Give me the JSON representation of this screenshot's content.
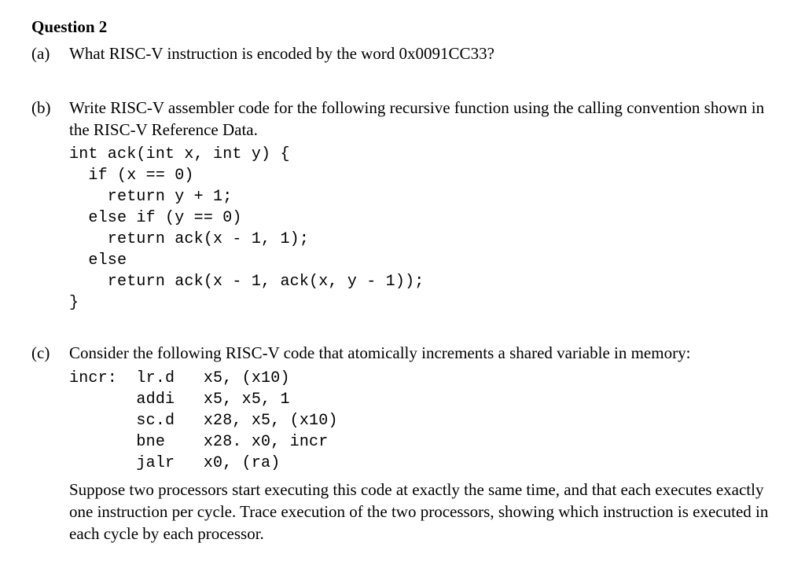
{
  "title": "Question 2",
  "parts": {
    "a": {
      "label": "(a)",
      "text": "What RISC-V instruction is encoded by the word 0x0091CC33?"
    },
    "b": {
      "label": "(b)",
      "text": "Write RISC-V assembler code for the following recursive function using the calling convention shown in the RISC-V Reference Data.",
      "code": "int ack(int x, int y) {\n  if (x == 0)\n    return y + 1;\n  else if (y == 0)\n    return ack(x - 1, 1);\n  else\n    return ack(x - 1, ack(x, y - 1));\n}"
    },
    "c": {
      "label": "(c)",
      "text": "Consider the following RISC-V code that atomically increments a shared variable in memory:",
      "code": "incr:  lr.d   x5, (x10)\n       addi   x5, x5, 1\n       sc.d   x28, x5, (x10)\n       bne    x28. x0, incr\n       jalr   x0, (ra)",
      "after": "Suppose two processors start executing this code at exactly the same time, and that each executes exactly one instruction per cycle. Trace execution of the two processors, showing which instruction is executed in each cycle by each processor."
    }
  }
}
